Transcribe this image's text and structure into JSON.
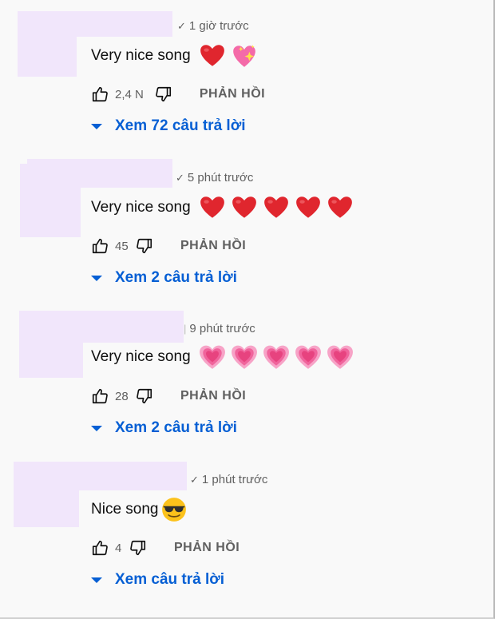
{
  "comments": [
    {
      "time": "1 giờ trước",
      "text": "Very nice song",
      "emojis": [
        "red-heart-icon",
        "sparkling-heart-icon"
      ],
      "likes": "2,4 N",
      "reply_label": "PHẢN HỒI",
      "view_replies": "Xem 72 câu trả lời"
    },
    {
      "time": "5 phút trước",
      "text": "Very nice song",
      "emojis": [
        "red-heart-icon",
        "red-heart-icon",
        "red-heart-icon",
        "red-heart-icon",
        "red-heart-icon"
      ],
      "likes": "45",
      "reply_label": "PHẢN HỒI",
      "view_replies": "Xem 2 câu trả lời"
    },
    {
      "time": "9 phút trước",
      "text": "Very nice song",
      "emojis": [
        "growing-heart-icon",
        "growing-heart-icon",
        "growing-heart-icon",
        "growing-heart-icon",
        "growing-heart-icon"
      ],
      "likes": "28",
      "reply_label": "PHẢN HỒI",
      "view_replies": "Xem 2 câu trả lời"
    },
    {
      "time": "1 phút trước",
      "text": "Nice song",
      "emojis": [
        "sunglasses-face-icon"
      ],
      "likes": "4",
      "reply_label": "PHẢN HỒI",
      "view_replies": "Xem câu trả lời"
    }
  ],
  "colors": {
    "link": "#065fd4",
    "meta": "#606060",
    "redaction": "#f1e6fb",
    "background": "#f9f9f9"
  }
}
